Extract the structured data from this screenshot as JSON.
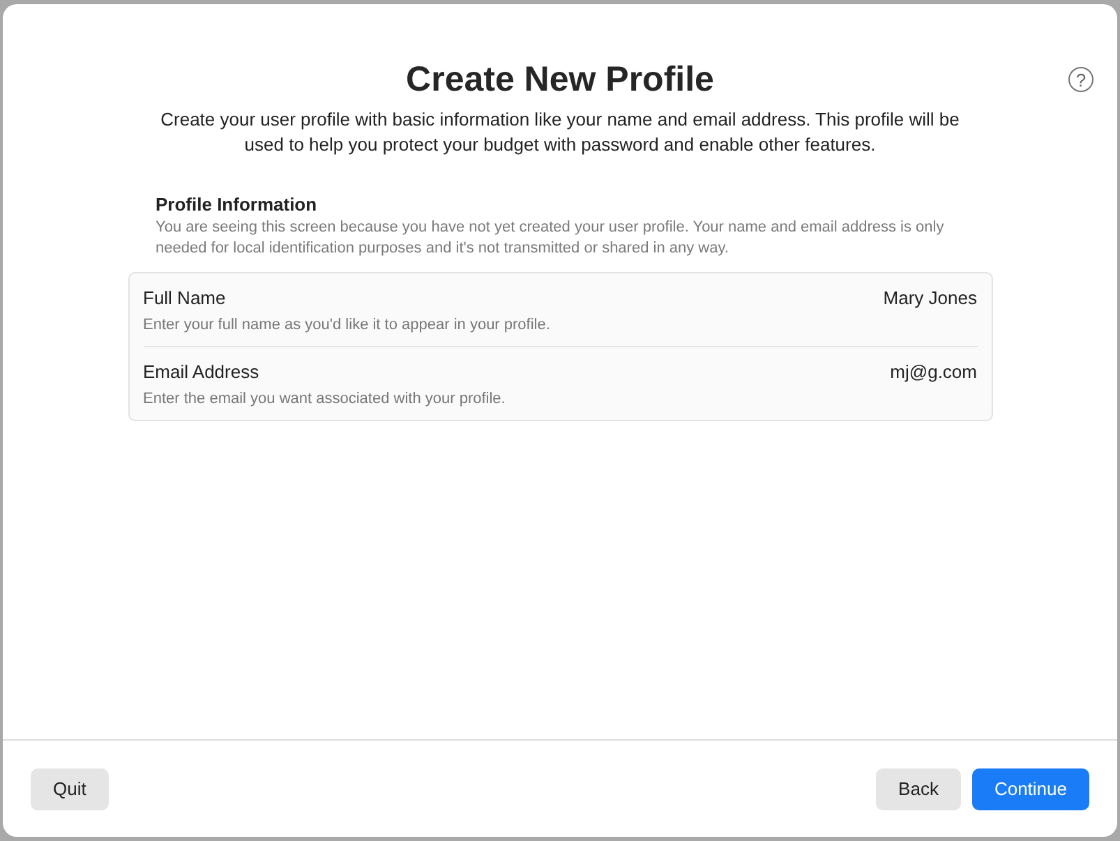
{
  "title": "Create New Profile",
  "subtitle": "Create your user profile with basic information like your name and email address. This profile will be used to help you protect your budget with password and enable other features.",
  "help_button": "?",
  "section": {
    "title": "Profile Information",
    "description": "You are seeing this screen because you have not yet created your user profile. Your name and email address is only needed for local identification purposes and it's not transmitted or shared in any way."
  },
  "fields": [
    {
      "label": "Full Name",
      "value": "Mary Jones",
      "hint": "Enter your full name as you'd like it to appear in your profile."
    },
    {
      "label": "Email Address",
      "value": "mj@g.com",
      "hint": "Enter the email you want associated with your profile."
    }
  ],
  "footer": {
    "left_buttons": [
      {
        "label": "Quit"
      }
    ],
    "right_buttons": [
      {
        "label": "Back",
        "kind": "normal"
      },
      {
        "label": "Continue",
        "kind": "primary"
      }
    ]
  }
}
